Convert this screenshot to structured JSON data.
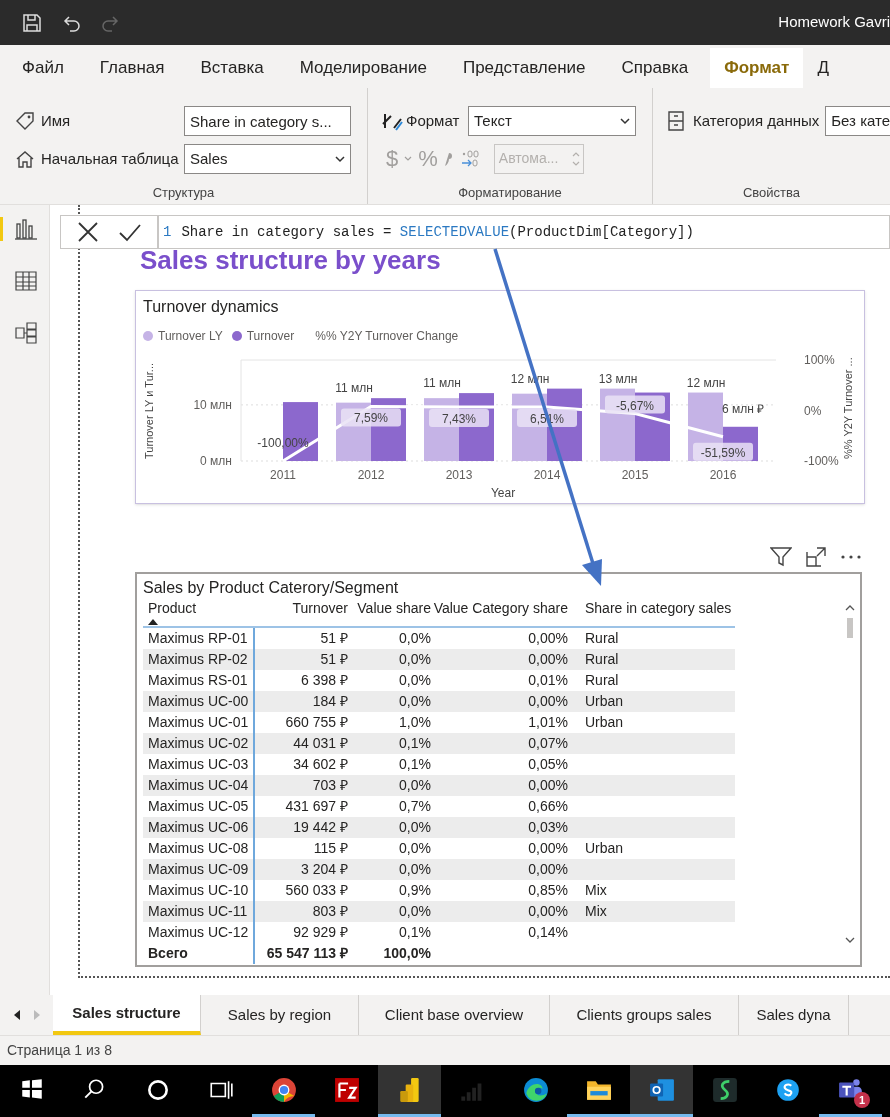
{
  "window": {
    "title": "Homework Gavri"
  },
  "menu_tabs": [
    {
      "label": "Файл",
      "selected": false
    },
    {
      "label": "Главная",
      "selected": false
    },
    {
      "label": "Вставка",
      "selected": false
    },
    {
      "label": "Моделирование",
      "selected": false
    },
    {
      "label": "Представление",
      "selected": false
    },
    {
      "label": "Справка",
      "selected": false
    },
    {
      "label": "Формат",
      "selected": true
    },
    {
      "label": "Д",
      "selected": false
    }
  ],
  "ribbon": {
    "structure": {
      "title": "Структура",
      "name": {
        "label": "Имя",
        "value": "Share in category s..."
      },
      "home_table": {
        "label": "Начальная таблица",
        "value": "Sales"
      }
    },
    "formatting": {
      "title": "Форматирование",
      "format": {
        "label": "Формат",
        "value": "Текст"
      },
      "symbols": [
        {
          "glyph": "$",
          "disabled": true
        },
        {
          "glyph": "%",
          "disabled": true
        }
      ],
      "decimals": {
        "value": "Автома...",
        "disabled": true
      }
    },
    "properties": {
      "title": "Свойства",
      "data_category": {
        "label": "Категория данных",
        "value": "Без кате"
      }
    }
  },
  "nav": [
    {
      "kind": "report",
      "selected": true
    },
    {
      "kind": "data",
      "selected": false
    },
    {
      "kind": "model",
      "selected": false
    }
  ],
  "formula": {
    "line_number": "1",
    "expression": "Share in category sales = ",
    "function": "SELECTEDVALUE",
    "arguments": "(ProductDim[Category])"
  },
  "report": {
    "heading": "Sales structure by years",
    "chart": {
      "title": "Turnover dynamics",
      "chart_data": {
        "type": "bar",
        "xlabel": "Year",
        "ylabel": "Turnover LY и Tur...",
        "ylim": [
          0,
          18
        ],
        "y2lim": [
          -100,
          100
        ],
        "categories": [
          "2011",
          "2012",
          "2013",
          "2014",
          "2015",
          "2016"
        ],
        "series": [
          {
            "name": "Turnover LY",
            "color": "#c5b3e6",
            "values": [
              null,
              10.4,
              11.2,
              12,
              12.9,
              12.2
            ]
          },
          {
            "name": "Turnover",
            "color": "#8c68cd",
            "values": [
              10.5,
              11.2,
              12.1,
              12.9,
              12.2,
              6.1
            ]
          },
          {
            "name": "%% Y2Y Turnover Change",
            "type": "line",
            "axis": "y2",
            "color": "#ffffff",
            "values": [
              -100,
              8,
              7,
              7,
              -6,
              -52
            ]
          }
        ],
        "yticks": [
          {
            "value": 0,
            "label": "0 млн"
          },
          {
            "value": 10,
            "label": "10 млн"
          }
        ],
        "y2ticks": [
          {
            "value": 100,
            "label": "100%"
          },
          {
            "value": 0,
            "label": "0%"
          },
          {
            "value": -100,
            "label": "-100%"
          }
        ]
      },
      "labels": [
        {
          "line": "-100,00%"
        },
        {
          "bar": "11 млн",
          "line": "7,59%"
        },
        {
          "bar": "11 млн",
          "line": "7,43%"
        },
        {
          "bar": "12 млн",
          "line": "6,51%"
        },
        {
          "bar": "13 млн",
          "line": "-5,67%"
        },
        {
          "bar": "12 млн",
          "turnover": "6 млн ₽",
          "line": "-51,59%"
        }
      ],
      "right_axis": {
        "title": "%% Y2Y Turnover ..."
      }
    },
    "table": {
      "title": "Sales by Product Caterory/Segment",
      "columns": [
        {
          "label": "Product",
          "sorted": true
        },
        {
          "label": "Turnover",
          "sorted": false
        },
        {
          "label": "Value share",
          "sorted": false
        },
        {
          "label": "Value Category share",
          "sorted": false
        },
        {
          "label": "Share in category sales",
          "sorted": false
        }
      ],
      "rows": [
        {
          "product": "Maximus RP-01",
          "turnover": "51 ₽",
          "value_share": "0,0%",
          "category_share": "0,00%",
          "share": "Rural"
        },
        {
          "product": "Maximus RP-02",
          "turnover": "51 ₽",
          "value_share": "0,0%",
          "category_share": "0,00%",
          "share": "Rural"
        },
        {
          "product": "Maximus RS-01",
          "turnover": "6 398 ₽",
          "value_share": "0,0%",
          "category_share": "0,01%",
          "share": "Rural"
        },
        {
          "product": "Maximus UC-00",
          "turnover": "184 ₽",
          "value_share": "0,0%",
          "category_share": "0,00%",
          "share": "Urban"
        },
        {
          "product": "Maximus UC-01",
          "turnover": "660 755 ₽",
          "value_share": "1,0%",
          "category_share": "1,01%",
          "share": "Urban"
        },
        {
          "product": "Maximus UC-02",
          "turnover": "44 031 ₽",
          "value_share": "0,1%",
          "category_share": "0,07%"
        },
        {
          "product": "Maximus UC-03",
          "turnover": "34 602 ₽",
          "value_share": "0,1%",
          "category_share": "0,05%"
        },
        {
          "product": "Maximus UC-04",
          "turnover": "703 ₽",
          "value_share": "0,0%",
          "category_share": "0,00%"
        },
        {
          "product": "Maximus UC-05",
          "turnover": "431 697 ₽",
          "value_share": "0,7%",
          "category_share": "0,66%"
        },
        {
          "product": "Maximus UC-06",
          "turnover": "19 442 ₽",
          "value_share": "0,0%",
          "category_share": "0,03%"
        },
        {
          "product": "Maximus UC-08",
          "turnover": "115 ₽",
          "value_share": "0,0%",
          "category_share": "0,00%",
          "share": "Urban"
        },
        {
          "product": "Maximus UC-09",
          "turnover": "3 204 ₽",
          "value_share": "0,0%",
          "category_share": "0,00%"
        },
        {
          "product": "Maximus UC-10",
          "turnover": "560 033 ₽",
          "value_share": "0,9%",
          "category_share": "0,85%",
          "share": "Mix"
        },
        {
          "product": "Maximus UC-11",
          "turnover": "803 ₽",
          "value_share": "0,0%",
          "category_share": "0,00%",
          "share": "Mix"
        },
        {
          "product": "Maximus UC-12",
          "turnover": "92 929 ₽",
          "value_share": "0,1%",
          "category_share": "0,14%"
        }
      ],
      "total": {
        "label": "Всего",
        "turnover": "65 547 113 ₽",
        "value_share": "100,0%"
      }
    }
  },
  "page_tabs": [
    {
      "label": "Sales structure",
      "selected": true
    },
    {
      "label": "Sales by region",
      "selected": false
    },
    {
      "label": "Client base overview",
      "selected": false
    },
    {
      "label": "Clients groups sales",
      "selected": false
    },
    {
      "label": "Sales dyna",
      "selected": false
    }
  ],
  "status_bar": "Страница 1 из 8",
  "taskbar": [
    {
      "kind": "start",
      "running": false,
      "active": false
    },
    {
      "kind": "search",
      "running": false,
      "active": false
    },
    {
      "kind": "cortana",
      "running": false,
      "active": false
    },
    {
      "kind": "taskview",
      "running": false,
      "active": false
    },
    {
      "kind": "chrome",
      "running": true,
      "active": false
    },
    {
      "kind": "filezilla",
      "running": false,
      "active": false
    },
    {
      "kind": "powerbi",
      "running": true,
      "active": true
    },
    {
      "kind": "bars",
      "running": false,
      "active": false
    },
    {
      "kind": "edge",
      "running": false,
      "active": false
    },
    {
      "kind": "explorer",
      "running": true,
      "active": false
    },
    {
      "kind": "outlook",
      "running": true,
      "active": true
    },
    {
      "kind": "sapp",
      "running": false,
      "active": false
    },
    {
      "kind": "skype",
      "running": false,
      "active": false
    },
    {
      "kind": "teams",
      "running": true,
      "active": false,
      "badge": "1"
    }
  ]
}
